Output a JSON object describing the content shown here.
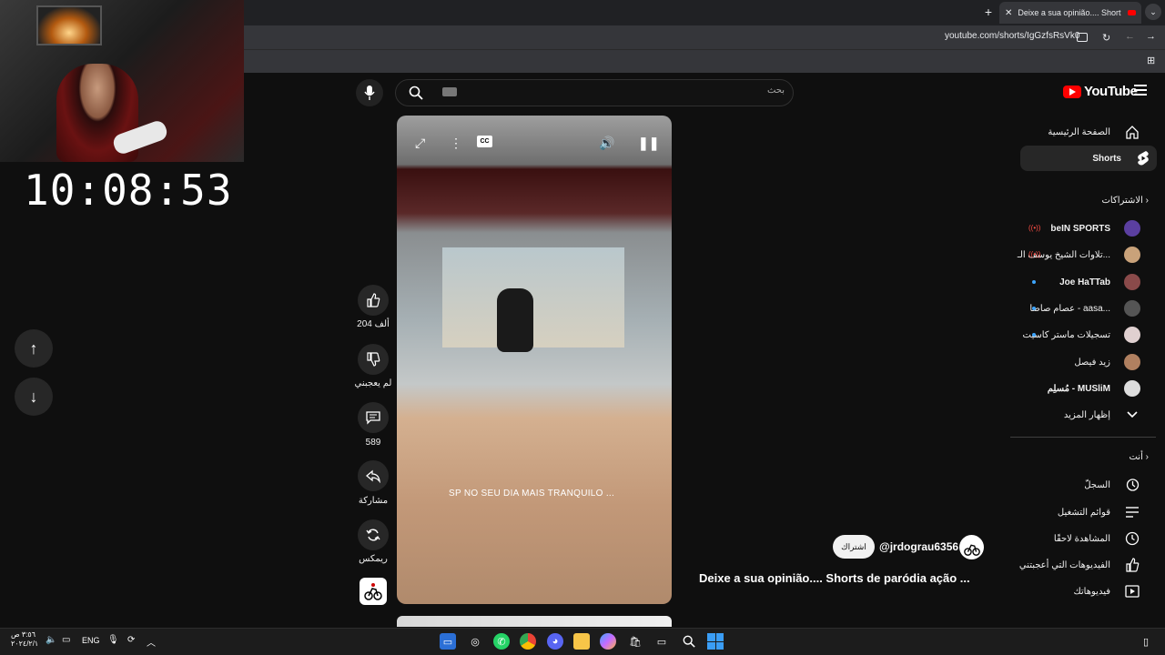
{
  "browser": {
    "tab_title": "Deixe a sua opinião.... Short",
    "new_tab": "+",
    "tab_menu": "⌄",
    "url": "youtube.com/shorts/IgGzfsRsVk0"
  },
  "overlay": {
    "clock": "10:08:53"
  },
  "nav": {
    "up": "↑",
    "down": "↓"
  },
  "topbar": {
    "search_placeholder": "بحث",
    "logo_text": "YouTube"
  },
  "video": {
    "cc": "CC",
    "caption": "SP NO SEU DIA MAIS TRANQUILO ..."
  },
  "actions": {
    "like_count": "204 ألف",
    "dislike_label": "لم يعجبني",
    "comments_count": "589",
    "share_label": "مشاركة",
    "remix_label": "ريمكس"
  },
  "channel": {
    "handle": "@jrdograu6356",
    "subscribe_label": "اشتراك",
    "title": "Deixe a sua opinião.... Shorts de paródia ação ..."
  },
  "sidebar": {
    "main": [
      {
        "label": "الصفحة الرئيسية",
        "icon": "home-icon"
      },
      {
        "label": "Shorts",
        "icon": "shorts-icon"
      }
    ],
    "subscriptions_header": "الاشتراكات",
    "subscriptions": [
      {
        "label": "beIN SPORTS",
        "indicator": "live",
        "avatar_color": "#5b3fa0"
      },
      {
        "label": "تلاوات الشيخ يوسف الـ...",
        "indicator": "live",
        "avatar_color": "#c9a27a"
      },
      {
        "label": "Joe HaTTab",
        "indicator": "new",
        "avatar_color": "#8a4a4a"
      },
      {
        "label": "عصام صاصا - aasa...",
        "indicator": "new",
        "avatar_color": "#555555"
      },
      {
        "label": "تسجيلات ماستر كاسيت",
        "indicator": "new",
        "avatar_color": "#e0d0d0"
      },
      {
        "label": "زيد فيصل",
        "indicator": "",
        "avatar_color": "#b08060"
      },
      {
        "label": "مُسلِم - MUSliM",
        "indicator": "",
        "avatar_color": "#dddddd"
      }
    ],
    "show_more": "إظهار المزيد",
    "you_header": "أنت",
    "you_items": [
      {
        "label": "السجلّ",
        "icon": "history-icon"
      },
      {
        "label": "قوائم التشغيل",
        "icon": "playlists-icon"
      },
      {
        "label": "المشاهدة لاحقًا",
        "icon": "watch-later-icon"
      },
      {
        "label": "الفيديوهات التي أعجبتني",
        "icon": "liked-icon"
      },
      {
        "label": "فيديوهاتك",
        "icon": "your-videos-icon"
      }
    ]
  },
  "taskbar": {
    "time": "٣:٥٦ ص",
    "date": "٢٠٢٤/٢/١",
    "language": "ENG"
  }
}
